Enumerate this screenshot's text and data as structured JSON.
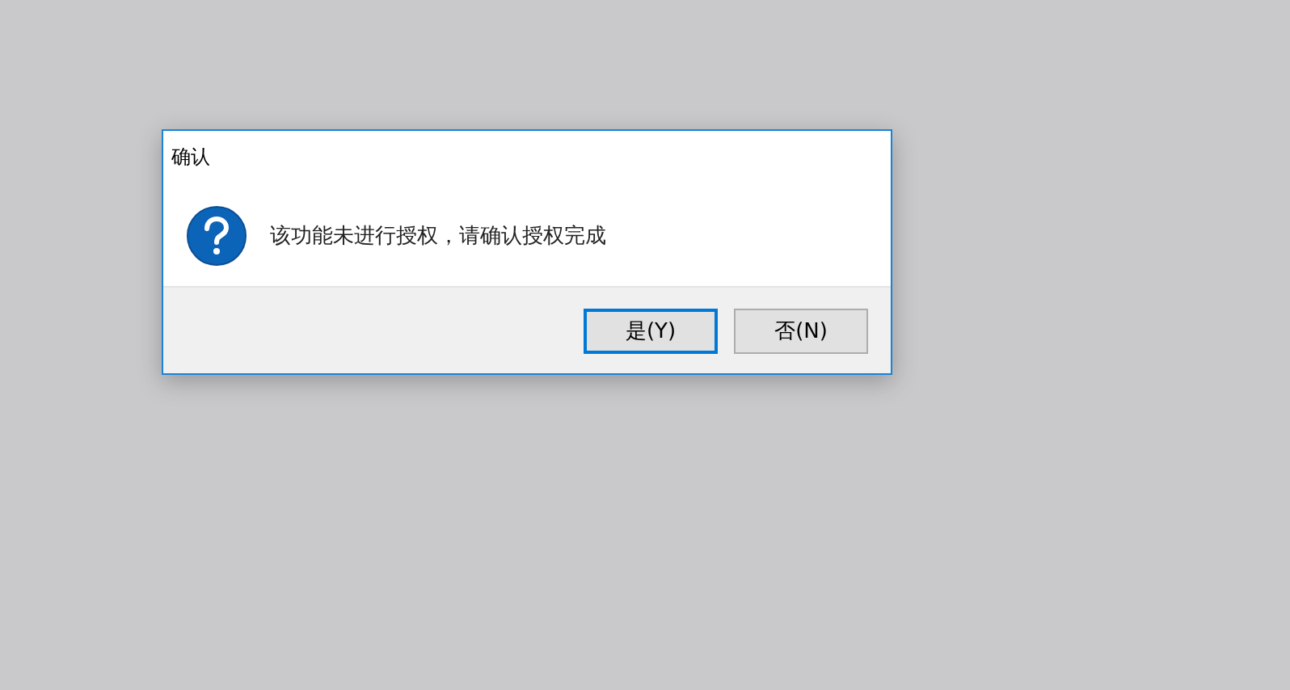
{
  "window": {
    "title": "确认"
  },
  "message": "该功能未进行授权，请确认授权完成",
  "buttons": [
    {
      "label": "是(Y)",
      "default": true
    },
    {
      "label": "否(N)",
      "default": false
    }
  ]
}
